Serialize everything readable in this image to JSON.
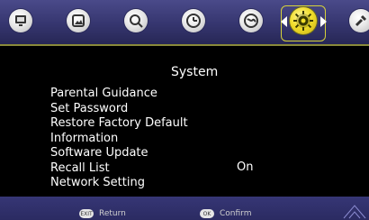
{
  "menu": {
    "title": "System",
    "items": [
      "Parental Guidance",
      "Set Password",
      "Restore Factory Default",
      "Information",
      "Software Update",
      "Recall List",
      "Network Setting"
    ],
    "recall_value": "On"
  },
  "footer": {
    "exit": {
      "key": "EXIT",
      "label": "Return"
    },
    "ok": {
      "key": "OK",
      "label": "Confirm"
    }
  },
  "icons": {
    "names": [
      "tv-icon",
      "picture-icon",
      "search-icon",
      "clock-icon",
      "globe-icon",
      "gear-icon",
      "tools-icon"
    ],
    "active": "gear-icon"
  },
  "colors": {
    "active_icon": "#f1de2b",
    "topbar": "#35356e",
    "bottom": "#363675",
    "text": "#ffffff"
  }
}
